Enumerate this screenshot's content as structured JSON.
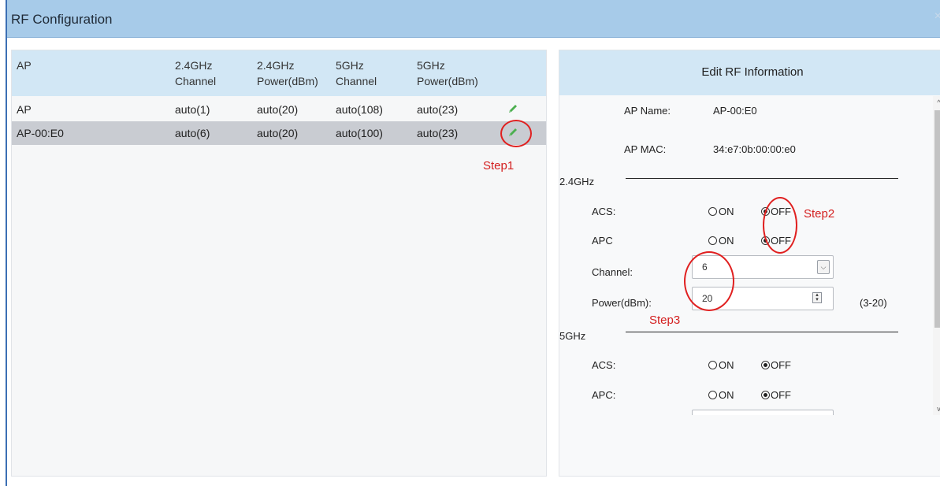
{
  "dialog": {
    "title": "RF Configuration",
    "close_glyph": "×"
  },
  "table": {
    "headers": [
      [
        "AP",
        ""
      ],
      [
        "2.4GHz",
        "Channel"
      ],
      [
        "2.4GHz",
        "Power(dBm)"
      ],
      [
        "5GHz",
        "Channel"
      ],
      [
        "5GHz",
        "Power(dBm)"
      ]
    ],
    "rows": [
      {
        "name": "AP",
        "ch24": "auto(1)",
        "pw24": "auto(20)",
        "ch5": "auto(108)",
        "pw5": "auto(23)",
        "selected": false
      },
      {
        "name": "AP-00:E0",
        "ch24": "auto(6)",
        "pw24": "auto(20)",
        "ch5": "auto(100)",
        "pw5": "auto(23)",
        "selected": true
      }
    ],
    "edit_icon": "pencil-icon"
  },
  "annotations": {
    "step1": "Step1",
    "step2": "Step2",
    "step3": "Step3",
    "color": "#e02020"
  },
  "edit": {
    "title": "Edit RF Information",
    "ap_name_label": "AP Name:",
    "ap_name": "AP-00:E0",
    "ap_mac_label": "AP MAC:",
    "ap_mac": "34:e7:0b:00:00:e0",
    "band24": {
      "label": "2.4GHz",
      "acs_label": "ACS:",
      "apc_label": "APC",
      "on": "ON",
      "off": "OFF",
      "acs": "OFF",
      "apc": "OFF",
      "channel_label": "Channel:",
      "channel_value": "6",
      "power_label": "Power(dBm):",
      "power_value": "20",
      "power_range": "(3-20)"
    },
    "band5": {
      "label": "5GHz",
      "acs_label": "ACS:",
      "apc_label": "APC:",
      "on": "ON",
      "off": "OFF",
      "acs": "OFF",
      "apc": "OFF"
    }
  },
  "colors": {
    "title_bar": "#a7cbe9",
    "header_bg": "#d2e7f5",
    "selected_row": "#c9ccd2",
    "pencil": "#4caf50"
  }
}
